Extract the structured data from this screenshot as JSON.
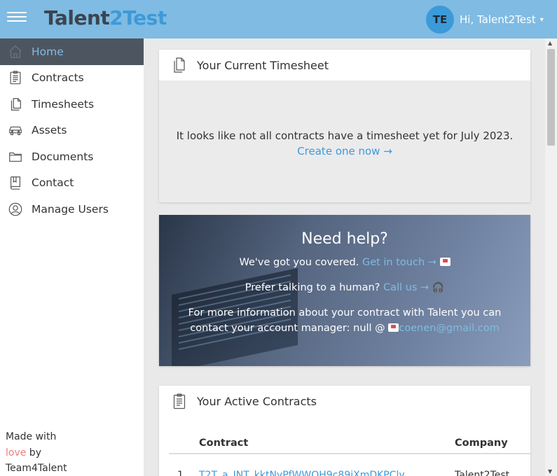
{
  "header": {
    "logo_part1": "Talent",
    "logo_part2": "2Test",
    "avatar_initials": "TE",
    "greeting": "Hi, Talent2Test",
    "caret": "▾"
  },
  "sidebar": {
    "items": [
      {
        "label": "Home",
        "icon": "home-icon",
        "active": true
      },
      {
        "label": "Contracts",
        "icon": "clipboard-icon"
      },
      {
        "label": "Timesheets",
        "icon": "document-icon"
      },
      {
        "label": "Assets",
        "icon": "car-icon"
      },
      {
        "label": "Documents",
        "icon": "folder-icon"
      },
      {
        "label": "Contact",
        "icon": "book-icon"
      },
      {
        "label": "Manage Users",
        "icon": "user-icon"
      }
    ],
    "footer": {
      "line1": "Made with",
      "love": "love",
      "by": " by",
      "line3": "Team4Talent"
    }
  },
  "timesheet_card": {
    "title": "Your Current Timesheet",
    "message": "It looks like not all contracts have a timesheet yet for July 2023.",
    "link": "Create one now →"
  },
  "help_card": {
    "title": "Need help?",
    "line1_text": "We've got you covered.",
    "line1_link": "Get in touch →",
    "line2_text": "Prefer talking to a human?",
    "line2_link": "Call us →",
    "line3_text": "For more information about your contract with Talent you can",
    "line4_text": "contact your account manager: null @",
    "line4_link": "coenen@gmail.com"
  },
  "contracts_card": {
    "title": "Your Active Contracts",
    "columns": [
      "Contract",
      "Company"
    ],
    "rows": [
      {
        "num": "1",
        "contract": "T2T_a_INT_kktNyPfWWOH9c89iXmDKPCly",
        "company": "Talent2Test"
      }
    ]
  }
}
